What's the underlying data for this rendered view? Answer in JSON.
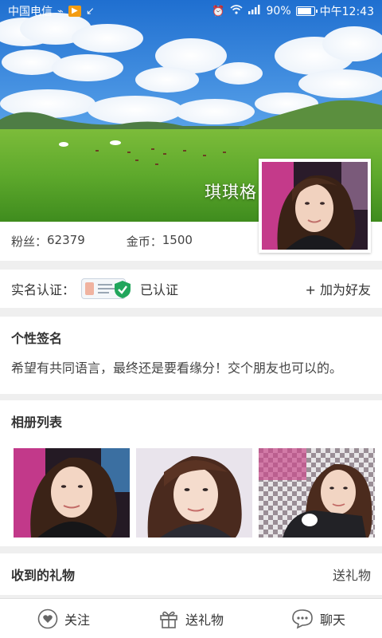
{
  "status_bar": {
    "carrier": "中国电信",
    "battery": "90%",
    "time": "中午12:43",
    "icons": [
      "usb-icon",
      "app-notification-icon",
      "missed-call-icon",
      "alarm-icon",
      "wifi-icon",
      "signal-4g-icon",
      "battery-icon"
    ]
  },
  "profile": {
    "nickname": "琪琪格",
    "fans_label": "粉丝：",
    "fans_value": "62379",
    "coins_label": "金币：",
    "coins_value": "1500"
  },
  "verification": {
    "label": "实名认证：",
    "status": "已认证",
    "add_friend": "+ 加为好友"
  },
  "signature": {
    "title": "个性签名",
    "text": "希望有共同语言，最终还是要看缘分！交个朋友也可以的。"
  },
  "album": {
    "title": "相册列表",
    "photo_count": 3
  },
  "gifts": {
    "title": "收到的礼物",
    "send_link": "送礼物"
  },
  "bottom_bar": {
    "follow": "关注",
    "send_gift": "送礼物",
    "chat": "聊天"
  },
  "colors": {
    "accent_green": "#21a65c",
    "page_bg": "#efefef",
    "sky": "#2f7fd6",
    "grass": "#5aa92a"
  }
}
